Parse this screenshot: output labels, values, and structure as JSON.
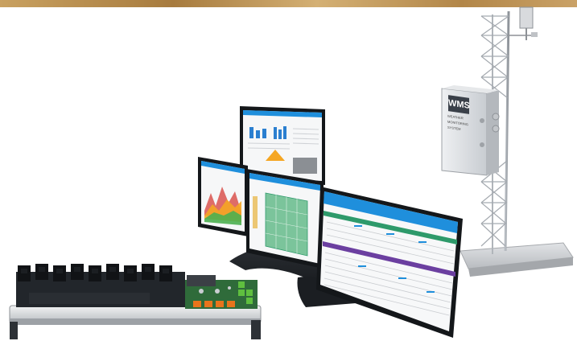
{
  "cabinet": {
    "label": "WMS",
    "sub_label": "WEATHER MONITORING SYSTEM"
  },
  "colors": {
    "header_blue": "#1f8fdc",
    "accent_green": "#2e9a6b",
    "accent_purple": "#6b3fa0",
    "chart_orange": "#f5a623",
    "chart_red": "#d9534f",
    "chart_green": "#4caf50",
    "pcb_green": "#2f6b3a",
    "terminal_orange": "#e8741c",
    "tower_grey": "#9aa0a6"
  },
  "icons": [
    "monitor-icon",
    "weather-station-icon",
    "tower-icon",
    "circuit-board-icon"
  ]
}
